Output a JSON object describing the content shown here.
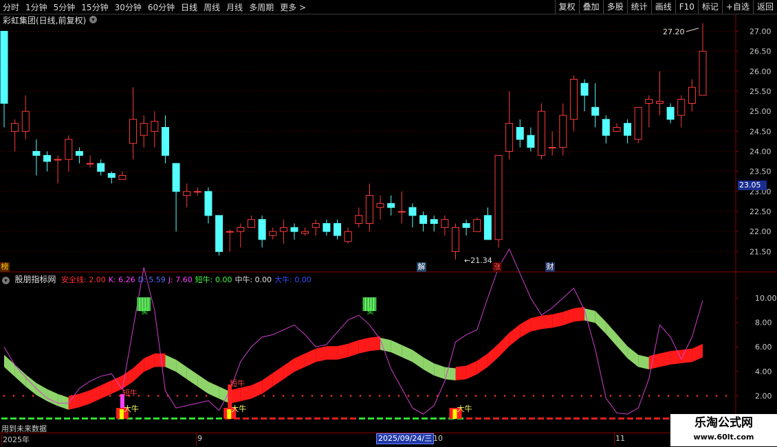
{
  "toolbar": {
    "periods": [
      "分时",
      "1分钟",
      "5分钟",
      "15分钟",
      "30分钟",
      "60分钟",
      "日线",
      "周线",
      "月线",
      "多周期",
      "更多 >"
    ],
    "active_period": "日线",
    "tools": [
      "复权",
      "叠加",
      "多股",
      "统计",
      "画线",
      "F10",
      "标记",
      "+自选",
      "返回"
    ]
  },
  "stock": {
    "title": "彩虹集团(日线,前复权)",
    "current_price_tag": "23.05"
  },
  "price_axis": {
    "labels": [
      "27.00",
      "26.50",
      "26.00",
      "25.50",
      "25.00",
      "24.50",
      "24.00",
      "23.50",
      "23.00",
      "22.50",
      "22.00",
      "21.50"
    ],
    "min": 21.3,
    "max": 27.3
  },
  "annotations": {
    "high": "27.20",
    "low": "21.34"
  },
  "event_markers": [
    {
      "text": "榜",
      "color": "#ffcc00",
      "bg": "#552200"
    },
    {
      "text": "解",
      "color": "#ffffff",
      "bg": "#224466"
    },
    {
      "text": "涨",
      "color": "#ff5050",
      "bg": "#440000"
    },
    {
      "text": "财",
      "color": "#ffffff",
      "bg": "#223366"
    }
  ],
  "indicator": {
    "name": "股朋指标网",
    "items": [
      {
        "label": "安全线: 2.00",
        "color": "#ff3030"
      },
      {
        "label": "K: 6.26",
        "color": "#ff40ff"
      },
      {
        "label": "D: 5.59",
        "color": "#5a6cff"
      },
      {
        "label": "J: 7.60",
        "color": "#ff40ff"
      },
      {
        "label": "短牛: 0.00",
        "color": "#40ff40"
      },
      {
        "label": "中牛: 0.00",
        "color": "#e0e0e0"
      },
      {
        "label": "大牛: 0.00",
        "color": "#3050ff"
      }
    ],
    "axis_labels": [
      "10.00",
      "8.00",
      "6.00",
      "4.00",
      "2.00"
    ],
    "signal_labels": {
      "duan_niu": "短牛",
      "da_niu": "大牛",
      "mai": "卖"
    }
  },
  "x_axis": {
    "labels": [
      "2025年",
      "9",
      "10",
      "11"
    ],
    "date_badge": "2025/09/24/三"
  },
  "future_label": "用到未来数据",
  "watermark": {
    "line1": "乐淘公式网",
    "line2": "www.60lt.com"
  },
  "colors": {
    "up": "#ff3b3b",
    "down": "#54ffff",
    "grid": "#6b0000"
  },
  "chart_data": {
    "type": "candlestick",
    "candles": [
      [
        27.0,
        25.2,
        27.0,
        24.6
      ],
      [
        24.5,
        24.7,
        24.8,
        24.0
      ],
      [
        24.5,
        25.0,
        25.4,
        24.3
      ],
      [
        24.0,
        23.9,
        24.3,
        23.4
      ],
      [
        23.9,
        23.75,
        24.0,
        23.5
      ],
      [
        23.8,
        23.8,
        23.9,
        23.2
      ],
      [
        23.8,
        24.3,
        24.4,
        23.5
      ],
      [
        24.0,
        23.9,
        24.1,
        23.7
      ],
      [
        23.7,
        23.7,
        23.9,
        23.6
      ],
      [
        23.7,
        23.5,
        23.8,
        23.4
      ],
      [
        23.45,
        23.35,
        23.5,
        23.2
      ],
      [
        23.3,
        23.4,
        23.5,
        23.3
      ],
      [
        24.2,
        24.8,
        25.6,
        23.8
      ],
      [
        24.4,
        24.7,
        24.9,
        24.1
      ],
      [
        24.5,
        24.75,
        25.0,
        24.1
      ],
      [
        24.6,
        23.9,
        24.9,
        23.7
      ],
      [
        23.7,
        23.0,
        23.7,
        22.0
      ],
      [
        22.9,
        23.0,
        23.2,
        22.6
      ],
      [
        23.0,
        23.0,
        23.1,
        22.9
      ],
      [
        23.0,
        22.4,
        23.1,
        22.2
      ],
      [
        22.4,
        21.5,
        22.4,
        21.4
      ],
      [
        22.0,
        22.0,
        22.05,
        21.5
      ],
      [
        22.0,
        22.1,
        22.2,
        21.6
      ],
      [
        22.1,
        22.3,
        22.4,
        22.1
      ],
      [
        22.3,
        21.8,
        22.4,
        21.6
      ],
      [
        21.9,
        22.0,
        22.1,
        21.8
      ],
      [
        22.0,
        22.1,
        22.3,
        21.7
      ],
      [
        22.1,
        22.0,
        22.2,
        21.8
      ],
      [
        21.95,
        22.0,
        22.1,
        21.9
      ],
      [
        22.1,
        22.2,
        22.3,
        21.9
      ],
      [
        22.2,
        22.0,
        22.3,
        21.9
      ],
      [
        22.2,
        21.9,
        22.3,
        21.8
      ],
      [
        21.75,
        22.0,
        22.1,
        21.7
      ],
      [
        22.2,
        22.4,
        22.6,
        22.1
      ],
      [
        22.2,
        22.9,
        23.2,
        22.0
      ],
      [
        22.6,
        22.7,
        22.9,
        22.3
      ],
      [
        22.7,
        22.6,
        22.9,
        22.4
      ],
      [
        22.5,
        22.5,
        23.0,
        22.2
      ],
      [
        22.6,
        22.4,
        22.7,
        22.1
      ],
      [
        22.4,
        22.2,
        22.5,
        22.0
      ],
      [
        22.3,
        22.2,
        22.4,
        22.0
      ],
      [
        22.1,
        22.3,
        22.4,
        21.9
      ],
      [
        21.5,
        22.1,
        22.2,
        21.3
      ],
      [
        22.2,
        22.1,
        22.3,
        21.9
      ],
      [
        22.0,
        22.3,
        22.35,
        22.0
      ],
      [
        22.4,
        21.8,
        22.6,
        21.8
      ],
      [
        21.8,
        23.9,
        23.9,
        21.6
      ],
      [
        24.0,
        24.7,
        25.5,
        23.8
      ],
      [
        24.6,
        24.3,
        24.8,
        24.1
      ],
      [
        24.4,
        24.1,
        24.6,
        24.0
      ],
      [
        23.9,
        25.0,
        25.2,
        23.8
      ],
      [
        24.1,
        24.1,
        24.5,
        23.9
      ],
      [
        24.1,
        24.9,
        25.2,
        23.9
      ],
      [
        24.8,
        25.8,
        25.9,
        24.5
      ],
      [
        25.7,
        25.4,
        25.8,
        25.0
      ],
      [
        25.1,
        24.9,
        25.7,
        24.6
      ],
      [
        24.8,
        24.4,
        24.9,
        24.2
      ],
      [
        24.5,
        24.6,
        24.7,
        24.5
      ],
      [
        24.7,
        24.4,
        24.8,
        24.2
      ],
      [
        24.3,
        25.1,
        25.1,
        24.2
      ],
      [
        25.2,
        25.3,
        25.4,
        24.6
      ],
      [
        25.2,
        25.25,
        26.0,
        24.9
      ],
      [
        25.1,
        24.8,
        25.2,
        24.7
      ],
      [
        24.9,
        25.3,
        25.4,
        24.6
      ],
      [
        25.2,
        25.6,
        25.8,
        25.0
      ],
      [
        25.4,
        26.5,
        27.2,
        25.4
      ]
    ],
    "kdj": {
      "K": [
        5.3,
        4.2,
        3.2,
        2.5,
        2.0,
        1.6,
        1.5,
        1.8,
        2.3,
        2.8,
        3.0,
        2.8,
        5.0,
        7.2,
        6.0,
        4.0,
        2.0,
        1.5,
        1.6,
        1.7,
        1.3,
        2.0,
        3.2,
        3.8,
        4.0,
        4.5,
        5.0,
        5.5,
        5.3,
        5.0,
        5.3,
        5.8,
        6.4,
        6.7,
        6.5,
        6.1,
        5.3,
        4.5,
        3.5,
        2.6,
        3.0,
        3.7,
        4.6,
        4.8,
        5.3,
        7.0,
        8.5,
        9.5,
        9.0,
        8.4,
        8.0,
        8.4,
        8.8,
        9.2,
        8.7,
        7.5,
        5.5,
        3.8,
        2.7,
        3.2,
        4.5,
        5.9,
        5.6,
        5.1,
        5.6,
        7.6
      ],
      "D": [
        4.8,
        4.0,
        3.2,
        2.5,
        2.0,
        1.6,
        1.3,
        1.5,
        1.8,
        2.2,
        2.6,
        3.0,
        3.6,
        4.4,
        4.8,
        4.8,
        4.4,
        3.8,
        3.2,
        2.6,
        2.2,
        1.8,
        2.0,
        2.2,
        2.6,
        3.2,
        3.8,
        4.4,
        4.8,
        5.2,
        5.4,
        5.4,
        5.6,
        5.9,
        6.1,
        6.2,
        6.0,
        5.6,
        5.2,
        4.6,
        4.1,
        3.8,
        3.7,
        3.8,
        4.2,
        4.8,
        5.6,
        6.5,
        7.2,
        7.7,
        7.9,
        8.0,
        8.2,
        8.5,
        8.6,
        8.4,
        7.5,
        6.5,
        5.5,
        4.8,
        4.6,
        4.8,
        5.0,
        5.1,
        5.2,
        5.59
      ],
      "J": [
        6.0,
        4.5,
        3.5,
        2.6,
        1.8,
        1.4,
        1.4,
        2.6,
        3.2,
        3.6,
        3.8,
        2.5,
        7.5,
        12.5,
        9.0,
        2.4,
        1.0,
        1.2,
        1.4,
        1.6,
        0.8,
        2.4,
        4.8,
        6.0,
        6.8,
        7.0,
        7.4,
        7.8,
        7.0,
        6.0,
        6.2,
        7.2,
        8.2,
        8.6,
        7.8,
        6.6,
        4.2,
        2.6,
        1.0,
        0.5,
        1.2,
        3.2,
        6.4,
        7.0,
        7.4,
        10.0,
        12.5,
        14.0,
        12.0,
        10.0,
        8.6,
        9.2,
        10.0,
        10.8,
        9.0,
        5.8,
        1.8,
        0.6,
        0.5,
        1.0,
        3.4,
        7.8,
        6.8,
        5.0,
        6.8,
        9.8
      ]
    }
  }
}
